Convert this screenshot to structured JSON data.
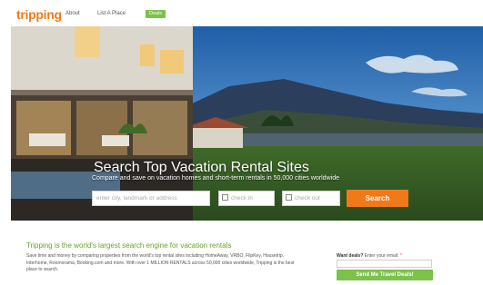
{
  "header": {
    "logo": "tripping",
    "nav": {
      "about": "About",
      "list_a_place": "List A Place",
      "deals": "Deals"
    }
  },
  "hero": {
    "headline": "Search Top Vacation Rental Sites",
    "subline": "Compare and save on vacation homes and short-term rentals in 50,000 cities worldwide"
  },
  "search": {
    "where_placeholder": "enter city, landmark or address",
    "checkin_placeholder": "check in",
    "checkout_placeholder": "check out",
    "button": "Search"
  },
  "info": {
    "tagline": "Tripping is the world's largest search engine for vacation rentals",
    "description": "Save time and money by comparing properties from the world's top rental sites including HomeAway, VRBO, FlipKey, Housetrip, Interhome, Roomorama, Booking.com and more. With over 1 MILLION RENTALS across 50,000 cities worldwide, Tripping is the best place to search."
  },
  "newsletter": {
    "label_bold": "Want deals?",
    "label_rest": "Enter your email:",
    "required_mark": "*",
    "button": "Send Me Travel Deals!"
  },
  "colors": {
    "brand_orange": "#f07a1a",
    "brand_green": "#7cc24a",
    "tagline_green": "#6ea02b"
  }
}
